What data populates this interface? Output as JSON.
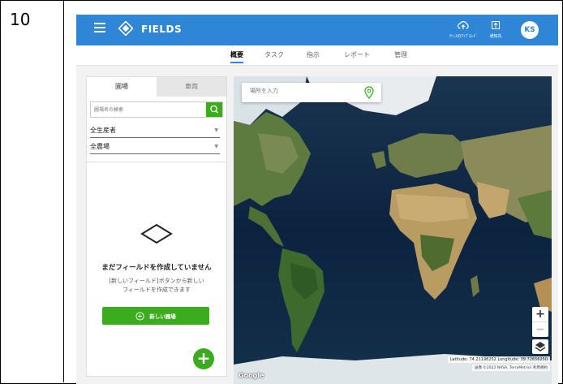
{
  "row_number": "10",
  "app": {
    "title": "FIELDS",
    "header_buttons": [
      {
        "label": "ﾘｿｰｽのｱｯﾌﾟﾛｰﾄﾞ",
        "icon": "cloud-upload-icon"
      },
      {
        "label": "通知先",
        "icon": "export-icon"
      }
    ],
    "avatar_initials": "KS",
    "brand_color": "#2f86d6",
    "accent_green": "#3aac1e"
  },
  "nav_tabs": [
    {
      "label": "概要",
      "active": true
    },
    {
      "label": "タスク",
      "active": false
    },
    {
      "label": "指示",
      "active": false
    },
    {
      "label": "レポート",
      "active": false
    },
    {
      "label": "管理",
      "active": false
    }
  ],
  "sidebar": {
    "tabs": [
      {
        "label": "圃場",
        "active": true
      },
      {
        "label": "車両",
        "active": false
      }
    ],
    "search_placeholder": "圃場名の検索",
    "producer_select": "全生産者",
    "farm_select": "全農場",
    "empty_title": "まだフィールドを作成していません",
    "empty_desc_line1": "[新しいフィールド]ボタンから新しい",
    "empty_desc_line2": "フィールドを作成できます",
    "new_field_button": "新しい圃場",
    "fab_label": "+"
  },
  "map": {
    "search_placeholder": "場所を入力",
    "coords_text": "Latitude: 74.21198252  Longitude: 39.72656250",
    "attribution": "画像 ©2022 NASA, TerraMetrics   利用規約",
    "provider_logo": "Google"
  }
}
